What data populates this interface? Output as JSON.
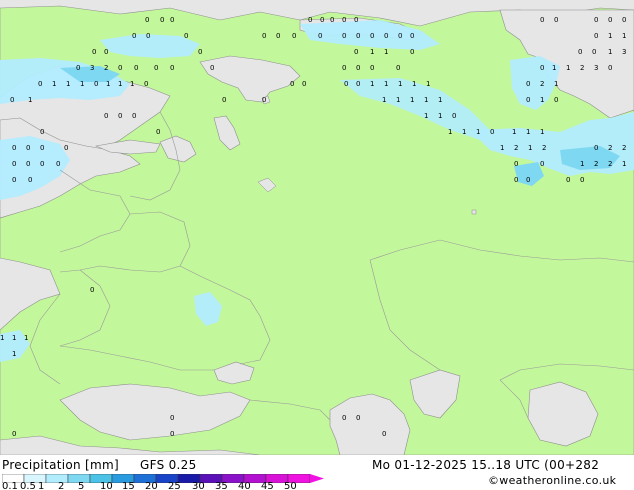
{
  "map": {
    "colors": {
      "sea": "#e6e6e6",
      "land": "#c3f79b",
      "precip_light": "#b2ecff",
      "precip_mid": "#7fd8f2",
      "border": "#9a9a9a"
    },
    "number_marks": [
      "0",
      "1",
      "2",
      "3",
      "0.5"
    ]
  },
  "footer": {
    "title": "Precipitation [mm]",
    "model": "GFS 0.25",
    "valid_time": "Mo 01-12-2025 15..18 UTC (00+282",
    "credit": "©weatheronline.co.uk"
  },
  "legend": {
    "ticks": [
      "0.1",
      "0.5",
      "1",
      "2",
      "5",
      "10",
      "15",
      "20",
      "25",
      "30",
      "35",
      "40",
      "45",
      "50"
    ],
    "colors": [
      "#fefefe",
      "#d9f6ff",
      "#b2ecff",
      "#7fd8f2",
      "#4cc3e6",
      "#2b9be0",
      "#1e6fd6",
      "#1a44c8",
      "#1a1aa8",
      "#5a12b8",
      "#8a12c8",
      "#b212d0",
      "#d912d8",
      "#f012e0"
    ]
  }
}
